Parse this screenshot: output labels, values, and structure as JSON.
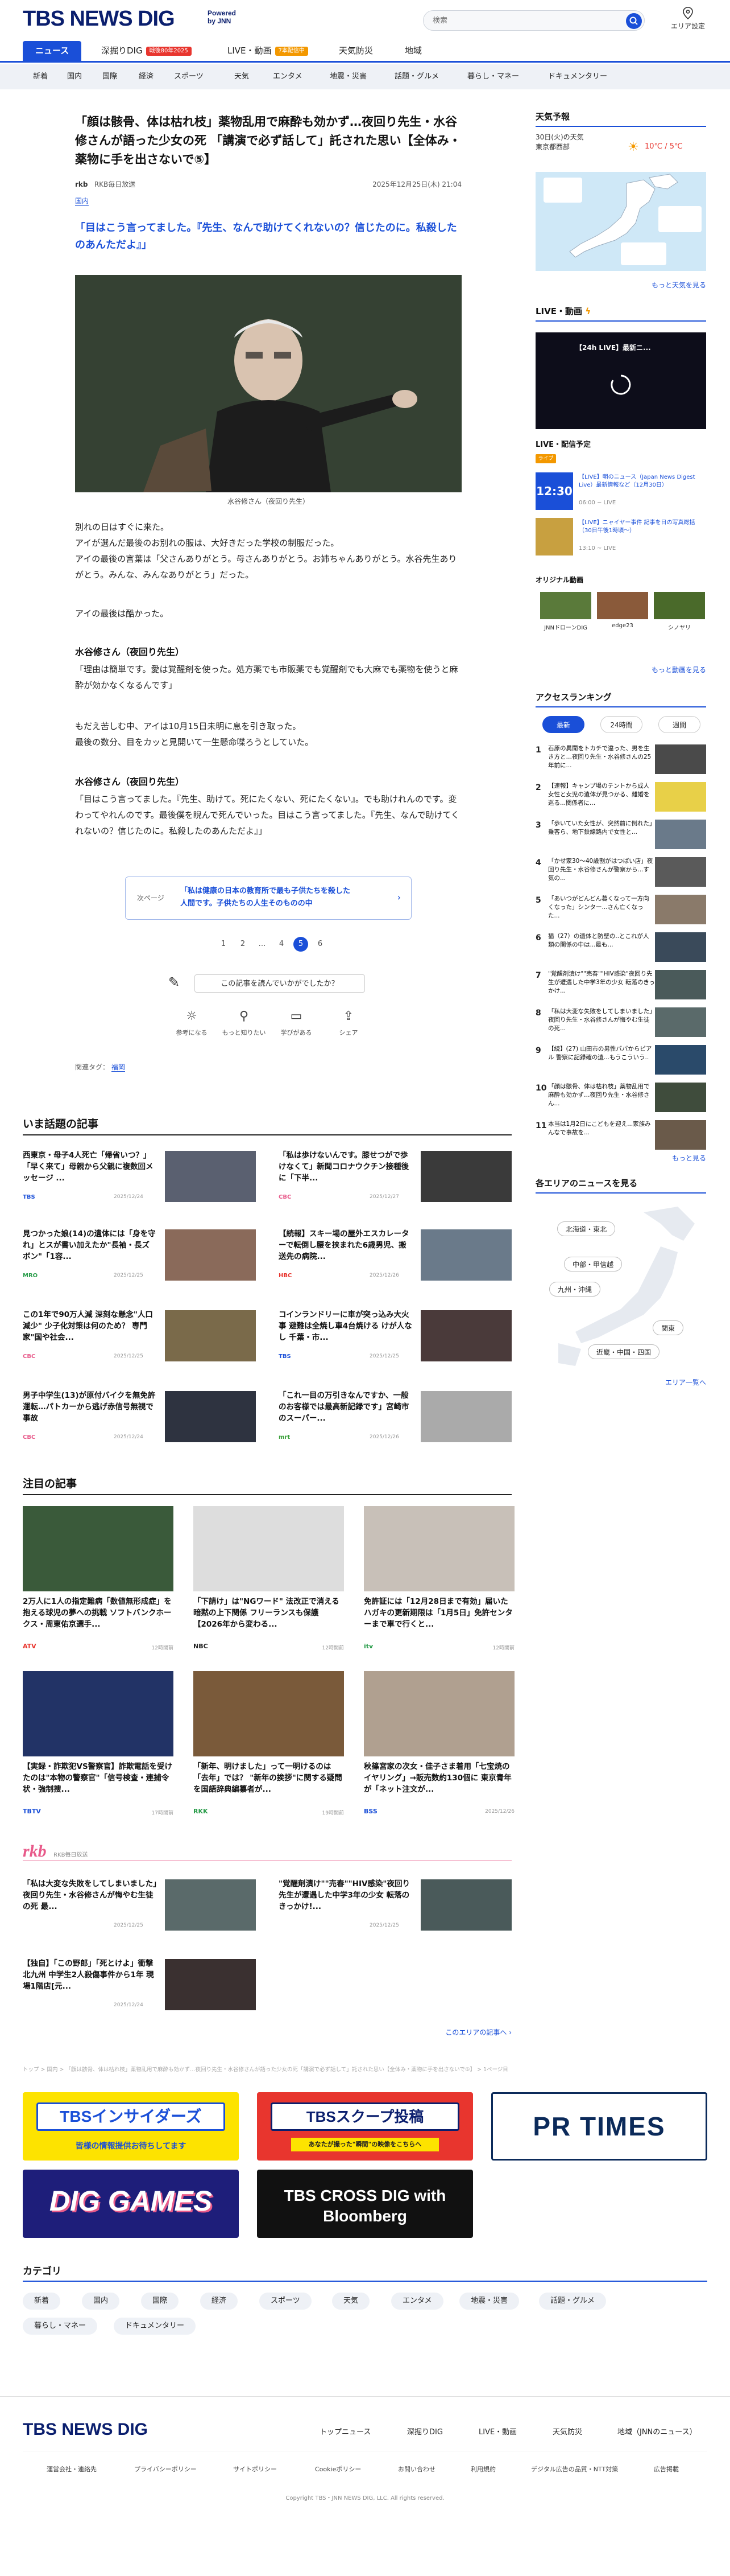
{
  "header": {
    "logo_main": "TBS NEWS DIG",
    "logo_powered": "Powered by JNN",
    "search_placeholder": "検索",
    "area_label": "エリア設定"
  },
  "nav_main": [
    {
      "label": "ニュース",
      "active": true
    },
    {
      "label": "深掘りDIG",
      "badge": "戦後80年2025"
    },
    {
      "label": "LIVE・動画",
      "badge": "7本配信中"
    },
    {
      "label": "天気防災"
    },
    {
      "label": "地域"
    }
  ],
  "nav_sub": [
    "新着",
    "国内",
    "国際",
    "経済",
    "スポーツ",
    "天気",
    "エンタメ",
    "地震・災害",
    "話題・グルメ",
    "暮らし・マネー",
    "ドキュメンタリー"
  ],
  "article": {
    "title": "「顔は骸骨、体は枯れ枝」薬物乱用で麻酔も効かず…夜回り先生・水谷修さんが語った少女の死 「講演で必ず話して」託された思い【全体み・薬物に手を出さないで⑤】",
    "source": "RKB毎日放送",
    "date": "2025年12月25日(木) 21:04",
    "category": "国内",
    "lead": "「目はこう言ってました。『先生、なんで助けてくれないの？信じたのに。私殺したのあんただよ』」",
    "photo_caption": "水谷修さん（夜回り先生）",
    "paragraphs_1": [
      "別れの日はすぐに来た。",
      "アイが選んだ最後のお別れの服は、大好きだった学校の制服だった。",
      "アイの最後の言葉は「父さんありがとう。母さんありがとう。お姉ちゃんありがとう。水谷先生ありがとう。みんな、みんなありがとう」だった。",
      "アイの最後は酷かった。"
    ],
    "speaker_1": "水谷修さん（夜回り先生）",
    "quote_1": "「理由は簡単です。愛は覚醒剤を使った。処方薬でも市販薬でも覚醒剤でも大麻でも薬物を使うと麻酔が効かなくなるんです」",
    "paragraphs_2": [
      "もだえ苦しむ中、アイは10月15日未明に息を引き取った。",
      "最後の数分、目をカッと見開いて一生懸命喋ろうとしていた。"
    ],
    "speaker_2": "水谷修さん（夜回り先生）",
    "quote_2": "「目はこう言ってました。『先生、助けて。死にたくない、死にたくない』。でも助けれんのです。変わってやれんのです。最後僕を睨んで死んでいった。目はこう言ってました。『先生、なんで助けてくれないの？信じたのに。私殺したのあんただよ』」",
    "next_label": "次ページ",
    "next_title": "「私は健康の日本の教育所で最も子供たちを殺した人間です。子供たちの人生そのものの中",
    "pages": [
      "1",
      "2",
      "…",
      "4",
      "5",
      "6"
    ],
    "current_page": "5",
    "ask_label": "この記事を読んでいかがでしたか？",
    "reactions": [
      "参考になる",
      "もっと知りたい",
      "学びがある",
      "シェア"
    ],
    "tags_label": "関連タグ：",
    "tag": "福岡"
  },
  "trending": {
    "heading": "いま話題の記事",
    "items": [
      {
        "title": "西東京・母子4人死亡「帰省いつ？」「早く来て」母親から父親に複数回メッセージ ...",
        "source": "TBS",
        "date": "2025/12/24"
      },
      {
        "title": "「私は歩けないんです。膝せつがで歩けなくて」新聞コロナウクチン接種後に「下半...",
        "source": "CBC",
        "date": "2025/12/27"
      },
      {
        "title": "見つかった娘(14)の遺体には「身を守れ」とスが書い加えたか\"長袖・長ズボン\"「1容...",
        "source": "MRO",
        "date": "2025/12/25"
      },
      {
        "title": "【続報】スキー場の屋外エスカレーターで転倒し腰を挟まれた6歳男児、搬送先の病院...",
        "source": "HBC",
        "date": "2025/12/26"
      },
      {
        "title": "この1年で90万人減 深刻な懸念\"人口減少\" 少子化対策は何のため？ 専門家\"国や社会...",
        "source": "CBC",
        "date": "2025/12/25"
      },
      {
        "title": "コインランドリーに車が突っ込み大火事 避難は全焼し車4台焼ける けが人なし 千葉・市...",
        "source": "TBS",
        "date": "2025/12/25"
      },
      {
        "title": "男子中学生(13)が原付バイクを無免許運転…パトカーから逃げ赤信号無視で事故",
        "source": "CBC",
        "date": "2025/12/24"
      },
      {
        "title": "「これ一目の万引きなんですか、一般のお客様では最高新記録です」宮崎市のスーパー...",
        "source": "mrt",
        "date": "2025/12/26"
      }
    ]
  },
  "featured": {
    "heading": "注目の記事",
    "items": [
      {
        "title": "2万人に1人の指定難病「数値無形成症」を抱える球児の夢への挑戦 ソフトバンクホークス・周東佑京選手...",
        "source": "ATV",
        "date": "12時間前"
      },
      {
        "title": "「下請け」は\"NGワード\" 法改正で消える暗黙の上下関係 フリーランスも保護【2026年から変わる...",
        "source": "NBC",
        "date": "12時間前"
      },
      {
        "title": "免許証には「12月28日まで有効」届いたハガキの更新期限は「1月5日」免許センターまで車で行くと...",
        "source": "itv",
        "date": "12時間前"
      },
      {
        "title": "【実録・詐欺犯VS警察官】詐欺電話を受けたのは\"本物の警察官\"「信号検査・連捕令状・強制捜...",
        "source": "TBTV",
        "date": "17時間前"
      },
      {
        "title": "「新年、明けました」って一明けるのは「去年」では？ \"新年の挨拶\"に関する疑問を国語辞典編纂者が...",
        "source": "RKK",
        "date": "19時間前"
      },
      {
        "title": "秋篠宮家の次女・佳子さま着用「七宝焼のイヤリング」→販売数約130個に 東京青年が「ネット注文が...",
        "source": "BSS",
        "date": "2025/12/26"
      }
    ]
  },
  "rkb": {
    "logo": "rkb",
    "label": "RKB毎日放送",
    "items": [
      {
        "title": "「私は大変な失敗をしてしまいました」夜回り先生・水谷修さんが悔やむ生徒の死 最...",
        "date": "2025/12/25"
      },
      {
        "title": "\"覚醒剤漬け\"\"売春\"\"HIV感染\"夜回り先生が遭遇した中学3年の少女 転落のきっかけ!...",
        "date": "2025/12/25"
      },
      {
        "title": "【独自】「この野郎」「死とけよ」衝撃 北九州 中学生2人殺傷事件から1年 現場1階店[元...",
        "date": "2025/12/24"
      }
    ],
    "more": "このエリアの記事へ"
  },
  "breadcrumb": "トップ > 国内 > 「顔は骸骨、体は枯れ枝」薬物乱用で麻酔も効かず…夜回り先生・水谷修さんが語った少女の死「講演で必ず話して」託された思い【全体み・薬物に手を出さないで⑤】 > 1ページ目",
  "banners": [
    "TBSインサイダーズ",
    "TBSスクープ投稿",
    "PR TIMES",
    "DIG GAMES",
    "TBS CROSS DIG with Bloomberg"
  ],
  "banner_sub": [
    "皆様の情報提供お待ちしてます",
    "あなたが撮った\"瞬間\"の映像をこちらへ"
  ],
  "categories": {
    "heading": "カテゴリ",
    "items": [
      "新着",
      "国内",
      "国際",
      "経済",
      "スポーツ",
      "天気",
      "エンタメ",
      "地震・災害",
      "話題・グルメ",
      "暮らし・マネー",
      "ドキュメンタリー"
    ]
  },
  "sidebar": {
    "weather_heading": "天気予報",
    "weather_date": "30日(火)の天気",
    "weather_place": "東京都西部",
    "weather_temps": "10℃ / 5℃",
    "weather_more": "もっと天気を見る",
    "live_heading": "LIVE・動画",
    "live_title": "【24h LIVE】最新ニ...",
    "live_schedule_heading": "LIVE・配信予定",
    "live_badge": "ライブ",
    "live_items": [
      {
        "time": "12:30",
        "title": "【LIVE】朝のニュース（Japan News Digest Live）最新情報など（12月30日）",
        "sub": "06:00 ~ LIVE"
      },
      {
        "time": "",
        "title": "【LIVE】ニャイヤー事件 記事を日の写真総括 （30日午後1時頃～）",
        "sub": "13:10 ~ LIVE"
      }
    ],
    "original_heading": "オリジナル動画",
    "original_items": [
      "JNNドローンDIG",
      "edge23",
      "シノヤリ"
    ],
    "original_more": "もっと動画を見る",
    "ranking_heading": "アクセスランキング",
    "ranking_tabs": [
      "最新",
      "24時間",
      "週間"
    ],
    "ranking": [
      {
        "n": "1",
        "title": "石原の異聞をトカチで違った、男を生き方と…夜回り先生・水谷修さんの25年前に..."
      },
      {
        "n": "2",
        "title": "【速報】キャンプ場のテントから成人女性と女児の遺体が見つかる、離婚を巡る...関係者に..."
      },
      {
        "n": "3",
        "title": "「歩いていた女性が、突然前に倒れた」乗客ら、地下鉄線路内で女性と..."
      },
      {
        "n": "4",
        "title": "「かせ家30〜40歳割がはつばい店」夜回り先生・水谷修さんが警察から...す気の..."
      },
      {
        "n": "5",
        "title": "「あいつがどんどん暮くなって一方向くなった」シンター...さん亡くなった..."
      },
      {
        "n": "6",
        "title": "猫（27）の遺体と防壁の..とこれが人類の関係の中は...最も..."
      },
      {
        "n": "7",
        "title": "\"覚醒剤漬け\"\"売春\"\"HIV感染\"夜回り先生が遭遇した中学3年の少女 転落のきっかけ..."
      },
      {
        "n": "8",
        "title": "「私は大変な失敗をしてしまいました」夜回り先生・水谷修さんが悔やむ生徒の死..."
      },
      {
        "n": "9",
        "title": "【続】(27) 山田市の男性パパからピアル 警察に記録確の遺...もうこういう.."
      },
      {
        "n": "10",
        "title": "「顔は骸骨、体は枯れ枝」薬物乱用で麻酔も効かず…夜回り先生・水谷修さん..."
      },
      {
        "n": "11",
        "title": "本当は1月2日にこどもを迎え...家族みんなで事故を..."
      }
    ],
    "ranking_more": "もっと見る",
    "area_heading": "各エリアのニュースを見る",
    "regions": [
      "北海道・東北",
      "中部・甲信越",
      "九州・沖縄",
      "関東",
      "近畿・中国・四国"
    ],
    "area_more": "エリア一覧へ"
  },
  "footer": {
    "logo": "TBS NEWS DIG",
    "nav": [
      "トップニュース",
      "深掘りDIG",
      "LIVE・動画",
      "天気防災",
      "地域（JNNのニュース）"
    ],
    "links": [
      "運営会社・連絡先",
      "プライバシーポリシー",
      "サイトポリシー",
      "Cookieポリシー",
      "お問い合わせ",
      "利用規約",
      "デジタル広告の品質・NTT対策",
      "広告掲載"
    ],
    "copyright": "Copyright TBS・JNN NEWS DIG, LLC. All rights reserved."
  },
  "colors": {
    "brand": "#0b1f6e",
    "accent": "#1a4fd8",
    "badge_red": "#e8352e",
    "badge_orange": "#f39800"
  }
}
